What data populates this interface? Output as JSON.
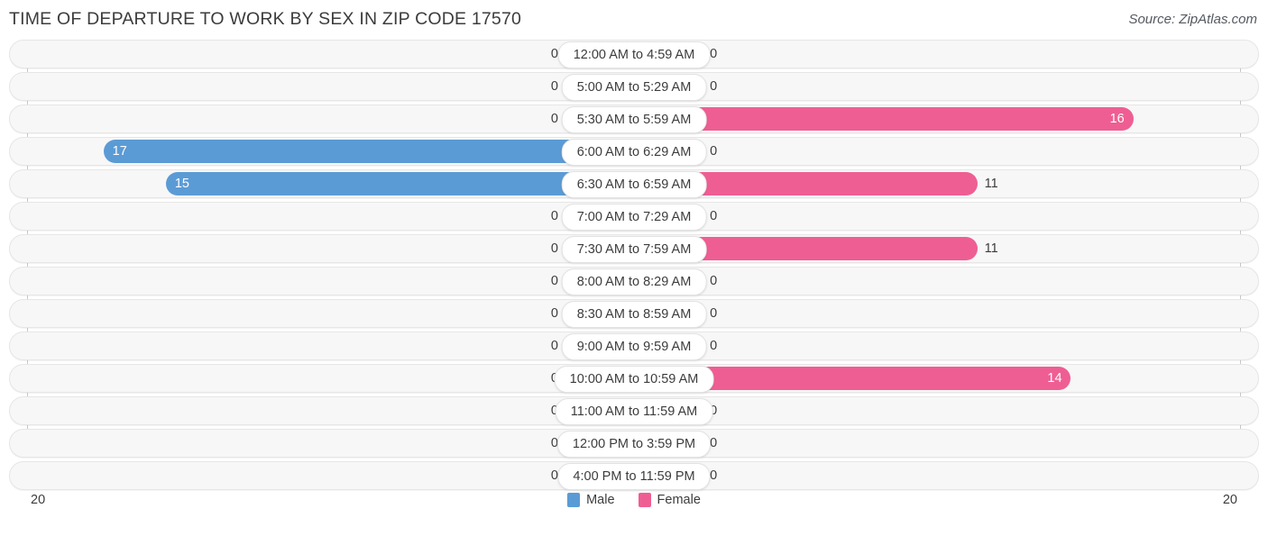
{
  "header": {
    "title": "TIME OF DEPARTURE TO WORK BY SEX IN ZIP CODE 17570",
    "source": "Source: ZipAtlas.com"
  },
  "legend": {
    "male_label": "Male",
    "female_label": "Female",
    "male_color": "#5b9bd5",
    "female_color": "#ef5e92"
  },
  "axis": {
    "left_tick": "20",
    "right_tick": "20"
  },
  "chart_data": {
    "type": "bar",
    "title": "TIME OF DEPARTURE TO WORK BY SEX IN ZIP CODE 17570",
    "subtitle": "Source: ZipAtlas.com",
    "orientation": "horizontal-diverging",
    "xlabel": "",
    "ylabel": "",
    "xlim": [
      20,
      20
    ],
    "grid": false,
    "legend_position": "bottom-center",
    "categories": [
      "12:00 AM to 4:59 AM",
      "5:00 AM to 5:29 AM",
      "5:30 AM to 5:59 AM",
      "6:00 AM to 6:29 AM",
      "6:30 AM to 6:59 AM",
      "7:00 AM to 7:29 AM",
      "7:30 AM to 7:59 AM",
      "8:00 AM to 8:29 AM",
      "8:30 AM to 8:59 AM",
      "9:00 AM to 9:59 AM",
      "10:00 AM to 10:59 AM",
      "11:00 AM to 11:59 AM",
      "12:00 PM to 3:59 PM",
      "4:00 PM to 11:59 PM"
    ],
    "series": [
      {
        "name": "Male",
        "color": "#5b9bd5",
        "values": [
          0,
          0,
          0,
          17,
          15,
          0,
          0,
          0,
          0,
          0,
          0,
          0,
          0,
          0
        ]
      },
      {
        "name": "Female",
        "color": "#ef5e92",
        "values": [
          0,
          0,
          16,
          0,
          11,
          0,
          11,
          0,
          0,
          0,
          14,
          0,
          0,
          0
        ]
      }
    ]
  }
}
